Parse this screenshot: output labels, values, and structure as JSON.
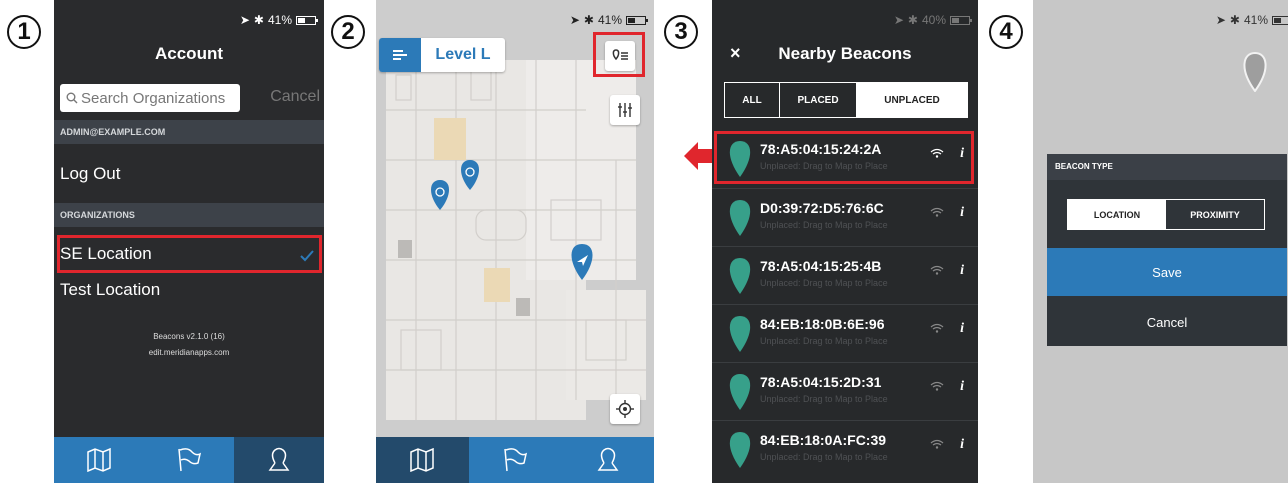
{
  "steps": [
    "1",
    "2",
    "3",
    "4"
  ],
  "status": {
    "battery": "41%",
    "battery_p3": "40%"
  },
  "p1": {
    "title": "Account",
    "search_placeholder": "Search Organizations",
    "cancel": "Cancel",
    "account_header": "ADMIN@EXAMPLE.COM",
    "logout": "Log Out",
    "org_header": "ORGANIZATIONS",
    "orgs": [
      "SE Location",
      "Test Location"
    ],
    "version": "Beacons v2.1.0 (16)",
    "domain": "edit.meridianapps.com"
  },
  "p2": {
    "level": "Level L"
  },
  "p3": {
    "title": "Nearby Beacons",
    "close": "×",
    "filters": [
      "ALL",
      "PLACED",
      "UNPLACED"
    ],
    "subtitle": "Unplaced: Drag to Map to Place",
    "info": "i",
    "beacons": [
      "78:A5:04:15:24:2A",
      "D0:39:72:D5:76:6C",
      "78:A5:04:15:25:4B",
      "84:EB:18:0B:6E:96",
      "78:A5:04:15:2D:31",
      "84:EB:18:0A:FC:39"
    ]
  },
  "p4": {
    "dialog_title": "BEACON TYPE",
    "options": [
      "LOCATION",
      "PROXIMITY"
    ],
    "save": "Save",
    "cancel": "Cancel"
  },
  "colors": {
    "accent": "#2c7ab8",
    "highlight": "#e0262d",
    "beacon": "#37a08a"
  },
  "icons": [
    "map-icon",
    "flag-icon",
    "user-icon",
    "search-icon",
    "checkmark-icon",
    "menu-icon",
    "beacon-list-icon",
    "filter-icon",
    "locate-icon",
    "wifi-icon",
    "pin-icon",
    "arrow-left-icon"
  ]
}
